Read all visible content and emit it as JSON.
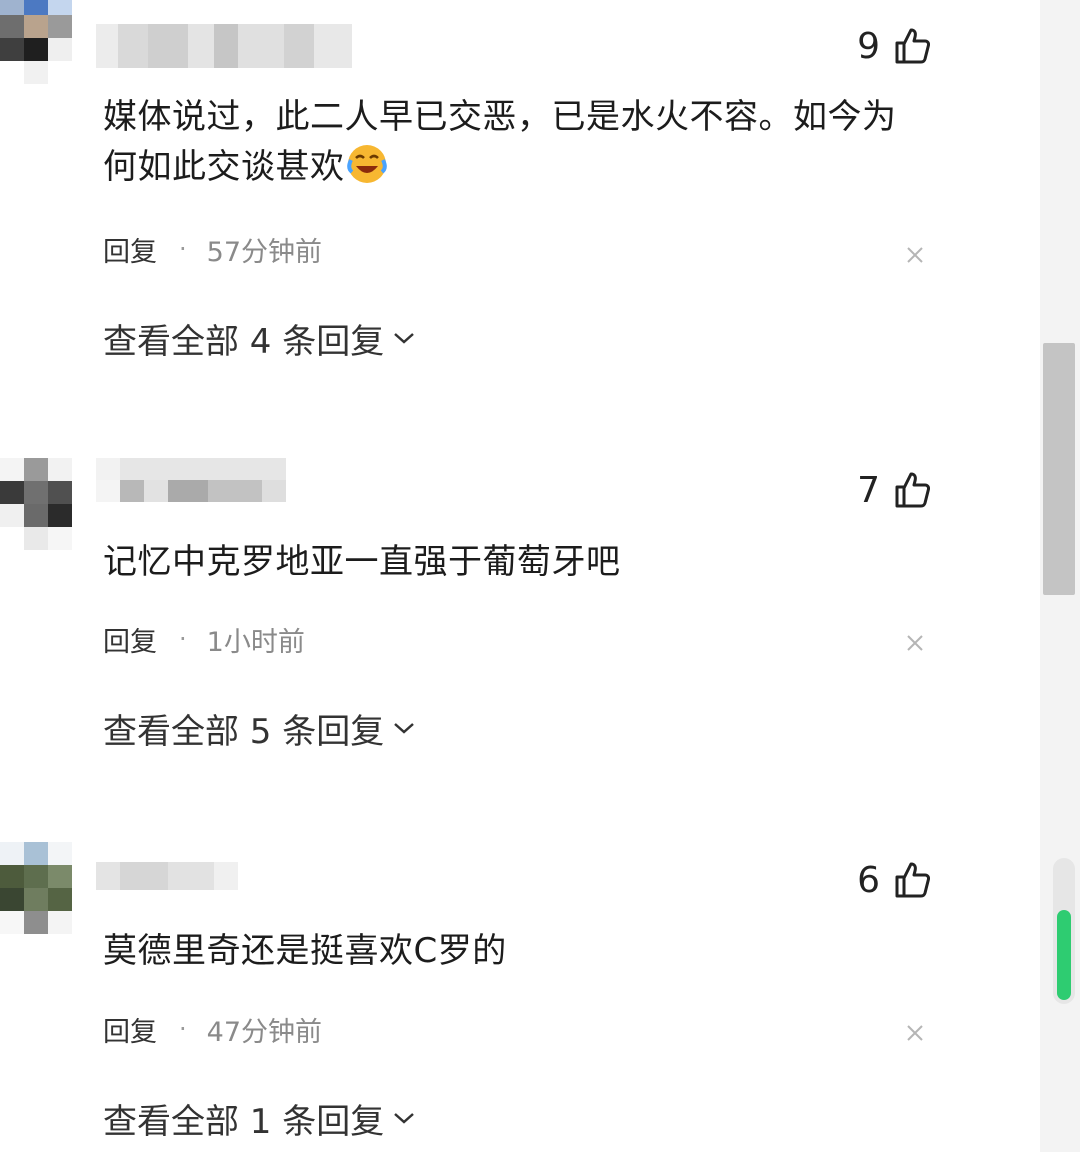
{
  "comments": [
    {
      "likes": "9",
      "text": "媒体说过，此二人早已交恶，已是水火不容。如今为何如此交谈甚欢",
      "emoji": "laughing-tears-emoji",
      "reply_label": "回复",
      "separator": "·",
      "time": "57分钟前",
      "view_all": "查看全部 4 条回复"
    },
    {
      "likes": "7",
      "text": "记忆中克罗地亚一直强于葡萄牙吧",
      "reply_label": "回复",
      "separator": "·",
      "time": "1小时前",
      "view_all": "查看全部 5 条回复"
    },
    {
      "likes": "6",
      "text": "莫德里奇还是挺喜欢C罗的",
      "reply_label": "回复",
      "separator": "·",
      "time": "47分钟前",
      "view_all": "查看全部 1 条回复"
    }
  ],
  "icons": {
    "like": "thumbs-up-icon",
    "close": "close-icon",
    "expand": "chevron-down-icon"
  },
  "colors": {
    "text": "#1c1c1c",
    "meta": "#8a8a8a",
    "accent_green": "#2ecc71"
  }
}
